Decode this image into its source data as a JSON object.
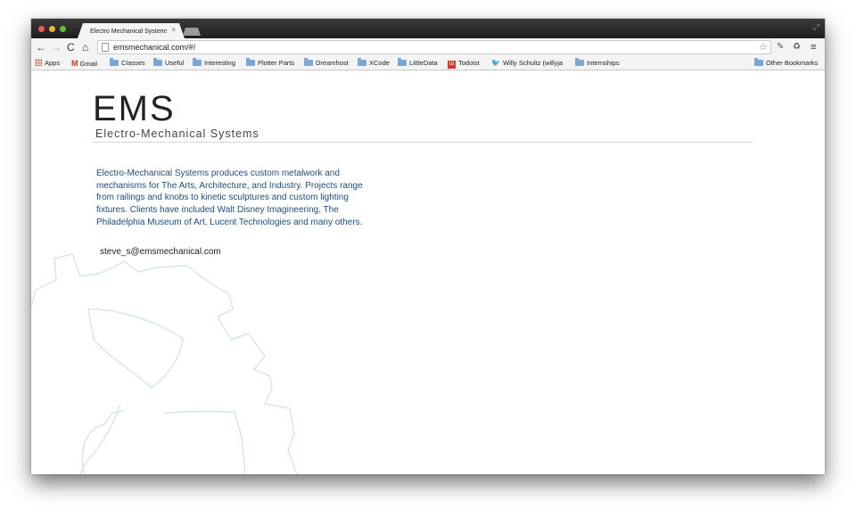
{
  "browser": {
    "tab": {
      "title": "Electro Mechanical Systems",
      "close_glyph": "×"
    },
    "toolbar": {
      "url": "emsmechanical.com/#/",
      "back_glyph": "←",
      "forward_glyph": "→",
      "reload_glyph": "C",
      "home_glyph": "⌂",
      "star_glyph": "☆",
      "menu_glyph": "≡"
    },
    "bookmarks": [
      {
        "label": "Apps",
        "icon": "apps-grid-icon"
      },
      {
        "label": "Gmail",
        "icon": "gmail-icon"
      },
      {
        "label": "Classes",
        "icon": "folder-icon"
      },
      {
        "label": "Useful",
        "icon": "folder-icon"
      },
      {
        "label": "Interesting",
        "icon": "folder-icon"
      },
      {
        "label": "Plotter Parts",
        "icon": "folder-icon"
      },
      {
        "label": "Dreamhost",
        "icon": "folder-icon"
      },
      {
        "label": "XCode",
        "icon": "folder-icon"
      },
      {
        "label": "LittleData",
        "icon": "folder-icon"
      },
      {
        "label": "Todoist",
        "icon": "todoist-icon"
      },
      {
        "label": "Willy Schultz (willyja",
        "icon": "twitter-icon"
      },
      {
        "label": "Internships",
        "icon": "folder-icon"
      }
    ],
    "other_bookmarks": "Other Bookmarks"
  },
  "page": {
    "logo": "EMS",
    "tagline": "Electro-Mechanical Systems",
    "description": "Electro-Mechanical Systems produces custom metalwork and mechanisms for The Arts, Architecture, and Industry. Projects range from railings and knobs to kinetic sculptures and custom lighting fixtures. Clients have included Walt Disney Imagineering, The Philadelphia Museum of Art, Lucent Technologies and many others.",
    "email": "steve_s@emsmechanical.com"
  },
  "colors": {
    "description_text": "#1c4e80",
    "gear_outline": "#cfe0ef"
  }
}
